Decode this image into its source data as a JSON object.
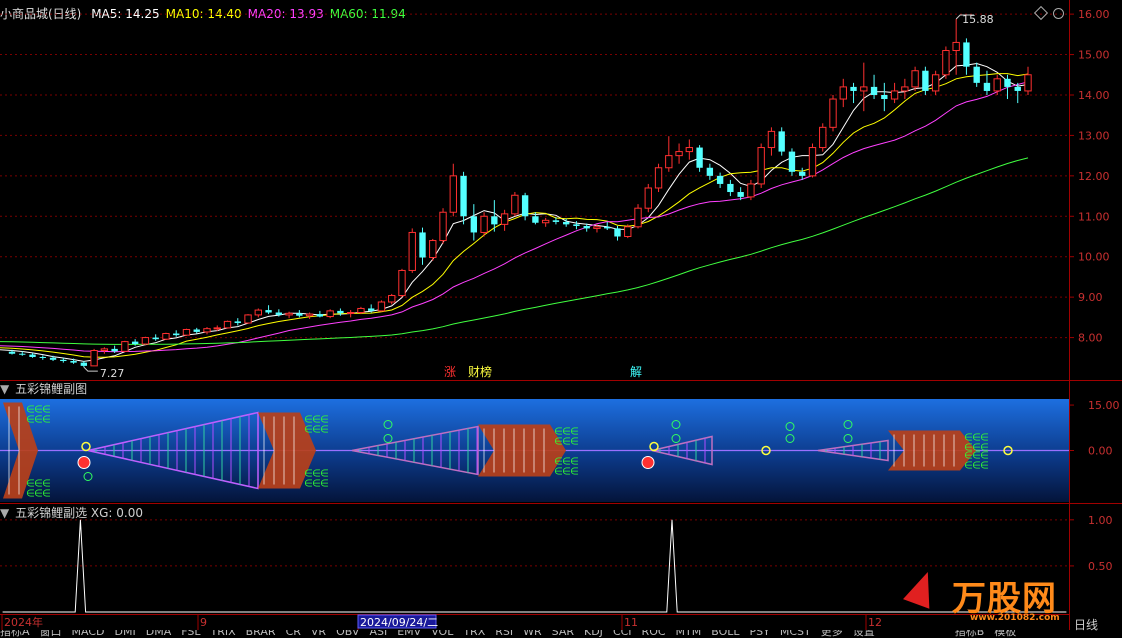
{
  "main": {
    "stock_name": "小商品城(日线)",
    "ma_labels": [
      {
        "label": "MA5: 14.25",
        "color": "#ffffff"
      },
      {
        "label": "MA10: 14.40",
        "color": "#ffff00"
      },
      {
        "label": "MA20: 13.93",
        "color": "#ff40ff"
      },
      {
        "label": "MA60: 11.94",
        "color": "#40ff40"
      }
    ],
    "high_label": "15.88",
    "low_label": "7.27",
    "y_ticks": [
      "16.00",
      "15.00",
      "14.00",
      "13.00",
      "12.00",
      "11.00",
      "10.00",
      "9.00",
      "8.00"
    ],
    "y_range": [
      7.0,
      16.3
    ],
    "markers": [
      {
        "label": "涨",
        "color": "#ff3030"
      },
      {
        "label": "财榜",
        "color": "#ffff40"
      },
      {
        "label": "解",
        "color": "#40ffff"
      }
    ],
    "colors": {
      "up": "#ff3030",
      "down": "#54ffff",
      "ma5": "#ffffff",
      "ma10": "#ffff00",
      "ma20": "#ff40ff",
      "ma60": "#40ff40"
    },
    "candles": [
      [
        7.65,
        7.7,
        7.58,
        7.6
      ],
      [
        7.6,
        7.66,
        7.55,
        7.58
      ],
      [
        7.58,
        7.62,
        7.5,
        7.52
      ],
      [
        7.52,
        7.56,
        7.45,
        7.5
      ],
      [
        7.5,
        7.55,
        7.42,
        7.45
      ],
      [
        7.45,
        7.5,
        7.38,
        7.42
      ],
      [
        7.42,
        7.48,
        7.35,
        7.38
      ],
      [
        7.38,
        7.42,
        7.27,
        7.3
      ],
      [
        7.3,
        7.72,
        7.3,
        7.68
      ],
      [
        7.68,
        7.76,
        7.6,
        7.72
      ],
      [
        7.72,
        7.8,
        7.62,
        7.66
      ],
      [
        7.66,
        7.92,
        7.64,
        7.9
      ],
      [
        7.9,
        7.96,
        7.8,
        7.84
      ],
      [
        7.84,
        8.02,
        7.82,
        8.0
      ],
      [
        8.0,
        8.08,
        7.92,
        7.96
      ],
      [
        7.96,
        8.12,
        7.94,
        8.1
      ],
      [
        8.1,
        8.18,
        8.02,
        8.06
      ],
      [
        8.06,
        8.22,
        8.04,
        8.2
      ],
      [
        8.2,
        8.24,
        8.1,
        8.14
      ],
      [
        8.14,
        8.26,
        8.08,
        8.22
      ],
      [
        8.22,
        8.3,
        8.16,
        8.24
      ],
      [
        8.24,
        8.42,
        8.22,
        8.4
      ],
      [
        8.4,
        8.48,
        8.3,
        8.36
      ],
      [
        8.36,
        8.58,
        8.34,
        8.56
      ],
      [
        8.56,
        8.72,
        8.5,
        8.68
      ],
      [
        8.68,
        8.8,
        8.58,
        8.62
      ],
      [
        8.62,
        8.7,
        8.52,
        8.56
      ],
      [
        8.56,
        8.64,
        8.48,
        8.6
      ],
      [
        8.6,
        8.68,
        8.5,
        8.54
      ],
      [
        8.54,
        8.62,
        8.46,
        8.58
      ],
      [
        8.58,
        8.66,
        8.5,
        8.52
      ],
      [
        8.52,
        8.7,
        8.48,
        8.66
      ],
      [
        8.66,
        8.72,
        8.54,
        8.6
      ],
      [
        8.6,
        8.68,
        8.5,
        8.62
      ],
      [
        8.62,
        8.76,
        8.58,
        8.72
      ],
      [
        8.72,
        8.82,
        8.62,
        8.66
      ],
      [
        8.66,
        8.92,
        8.64,
        8.88
      ],
      [
        8.88,
        9.08,
        8.82,
        9.04
      ],
      [
        9.04,
        9.7,
        9.0,
        9.66
      ],
      [
        9.66,
        10.7,
        9.6,
        10.6
      ],
      [
        10.6,
        10.72,
        9.8,
        9.98
      ],
      [
        9.98,
        10.44,
        9.9,
        10.4
      ],
      [
        10.4,
        11.2,
        10.32,
        11.1
      ],
      [
        11.1,
        12.3,
        11.0,
        12.0
      ],
      [
        12.0,
        12.1,
        10.8,
        11.0
      ],
      [
        11.0,
        11.3,
        10.4,
        10.6
      ],
      [
        10.6,
        11.1,
        10.5,
        11.0
      ],
      [
        11.0,
        11.4,
        10.62,
        10.8
      ],
      [
        10.8,
        11.16,
        10.64,
        11.06
      ],
      [
        11.06,
        11.6,
        11.0,
        11.52
      ],
      [
        11.52,
        11.58,
        10.9,
        11.0
      ],
      [
        11.0,
        11.1,
        10.8,
        10.84
      ],
      [
        10.84,
        10.96,
        10.74,
        10.9
      ],
      [
        10.9,
        10.98,
        10.8,
        10.86
      ],
      [
        10.86,
        10.94,
        10.74,
        10.8
      ],
      [
        10.8,
        10.88,
        10.68,
        10.76
      ],
      [
        10.76,
        10.82,
        10.62,
        10.7
      ],
      [
        10.7,
        10.8,
        10.6,
        10.74
      ],
      [
        10.74,
        10.86,
        10.66,
        10.7
      ],
      [
        10.7,
        10.76,
        10.4,
        10.5
      ],
      [
        10.5,
        10.8,
        10.46,
        10.74
      ],
      [
        10.74,
        11.3,
        10.7,
        11.2
      ],
      [
        11.2,
        11.8,
        11.1,
        11.7
      ],
      [
        11.7,
        12.3,
        11.6,
        12.2
      ],
      [
        12.2,
        12.98,
        12.1,
        12.5
      ],
      [
        12.5,
        12.8,
        12.3,
        12.6
      ],
      [
        12.6,
        12.9,
        12.4,
        12.7
      ],
      [
        12.7,
        12.76,
        12.1,
        12.2
      ],
      [
        12.2,
        12.3,
        11.9,
        12.0
      ],
      [
        12.0,
        12.08,
        11.7,
        11.8
      ],
      [
        11.8,
        11.9,
        11.5,
        11.6
      ],
      [
        11.6,
        11.72,
        11.4,
        11.48
      ],
      [
        11.48,
        11.9,
        11.4,
        11.8
      ],
      [
        11.8,
        12.8,
        11.7,
        12.7
      ],
      [
        12.7,
        13.2,
        12.5,
        13.1
      ],
      [
        13.1,
        13.2,
        12.5,
        12.6
      ],
      [
        12.6,
        12.68,
        12.0,
        12.1
      ],
      [
        12.1,
        12.2,
        11.9,
        12.0
      ],
      [
        12.0,
        12.8,
        11.96,
        12.7
      ],
      [
        12.7,
        13.3,
        12.6,
        13.2
      ],
      [
        13.2,
        14.0,
        13.1,
        13.9
      ],
      [
        13.9,
        14.4,
        13.7,
        14.2
      ],
      [
        14.2,
        14.3,
        13.8,
        14.1
      ],
      [
        14.1,
        14.8,
        13.6,
        14.2
      ],
      [
        14.2,
        14.5,
        13.9,
        14.0
      ],
      [
        14.0,
        14.3,
        13.6,
        13.9
      ],
      [
        13.9,
        14.3,
        13.8,
        14.1
      ],
      [
        14.1,
        14.4,
        13.9,
        14.2
      ],
      [
        14.2,
        14.7,
        14.1,
        14.6
      ],
      [
        14.6,
        14.7,
        14.0,
        14.1
      ],
      [
        14.1,
        14.6,
        14.0,
        14.5
      ],
      [
        14.5,
        15.2,
        14.4,
        15.1
      ],
      [
        15.1,
        15.88,
        14.5,
        15.3
      ],
      [
        15.3,
        15.4,
        14.5,
        14.7
      ],
      [
        14.7,
        14.8,
        14.2,
        14.3
      ],
      [
        14.3,
        14.6,
        14.0,
        14.1
      ],
      [
        14.1,
        14.5,
        14.0,
        14.4
      ],
      [
        14.4,
        14.5,
        13.9,
        14.2
      ],
      [
        14.2,
        14.3,
        13.8,
        14.1
      ],
      [
        14.1,
        14.7,
        14.0,
        14.5
      ]
    ]
  },
  "sub1": {
    "title": "五彩锦鲤副图",
    "y_ticks": [
      "15.00",
      "0.00"
    ],
    "y_range": [
      -17,
      17
    ]
  },
  "sub2": {
    "title": "五彩锦鲤副选 XG: 0.00",
    "y_ticks": [
      "1.00",
      "0.50"
    ],
    "y_range": [
      0,
      1.15
    ],
    "line_color": "#ffffff",
    "signals": [
      0,
      0,
      0,
      0,
      0,
      0,
      0,
      0,
      0,
      0,
      0,
      0,
      0,
      0,
      0,
      1,
      0,
      0,
      0,
      0,
      0,
      0,
      0,
      0,
      0,
      0,
      0,
      0,
      0,
      0,
      0,
      0,
      0,
      0,
      0,
      0,
      0,
      0,
      0,
      0,
      0,
      0,
      0,
      0,
      0,
      0,
      0,
      0,
      0,
      0,
      0,
      0,
      0,
      0,
      0,
      0,
      0,
      0,
      0,
      0,
      0,
      0,
      0,
      0,
      0,
      0,
      0,
      0,
      0,
      0,
      0,
      0,
      0,
      0,
      0,
      0,
      0,
      0,
      0,
      0,
      0,
      0,
      0,
      0,
      0,
      0,
      0,
      0,
      0,
      0,
      0,
      0,
      0,
      0,
      0,
      0,
      0,
      0,
      0,
      0,
      0,
      0,
      0,
      0,
      0,
      0,
      0,
      0,
      0,
      0,
      0,
      0,
      0,
      0,
      0,
      0,
      0,
      0,
      0,
      0,
      0,
      0,
      0,
      0,
      0,
      0,
      0,
      0,
      0,
      1,
      0,
      0,
      0,
      0,
      0,
      0,
      0,
      0,
      0,
      0,
      0,
      0,
      0,
      0,
      0,
      0,
      0,
      0,
      0,
      0,
      0,
      0,
      0,
      0,
      0,
      0,
      0,
      0,
      0,
      0,
      0,
      0,
      0,
      0,
      0,
      0,
      0,
      0,
      0,
      0,
      0,
      0,
      0,
      0,
      0,
      0,
      0,
      0,
      0,
      0,
      0,
      0,
      0,
      0,
      0,
      0,
      0,
      0,
      0,
      0,
      0,
      0,
      0,
      0,
      0,
      0,
      0,
      0,
      0,
      0,
      0,
      0,
      0,
      0,
      0,
      0
    ]
  },
  "dates": [
    {
      "label": "2024年",
      "highlight": false
    },
    {
      "label": "9",
      "highlight": false
    },
    {
      "label": "2024/09/24/二",
      "highlight": true
    },
    {
      "label": "11",
      "highlight": false
    },
    {
      "label": "12",
      "highlight": false
    }
  ],
  "right_label": "日线",
  "toolbar": [
    "指标A",
    "窗口",
    "MACD",
    "DMI",
    "DMA",
    "FSL",
    "TRIX",
    "BRAR",
    "CR",
    "VR",
    "OBV",
    "ASI",
    "EMV",
    "VOL",
    "TRX",
    "RSI",
    "WR",
    "SAR",
    "KDJ",
    "CCI",
    "ROC",
    "MTM",
    "BOLL",
    "PSY",
    "MCST",
    "更多",
    "设置"
  ],
  "toolbar_right": [
    "指标B",
    "模板"
  ],
  "watermark": {
    "brand": "万股网",
    "url": "www.201082.com"
  }
}
